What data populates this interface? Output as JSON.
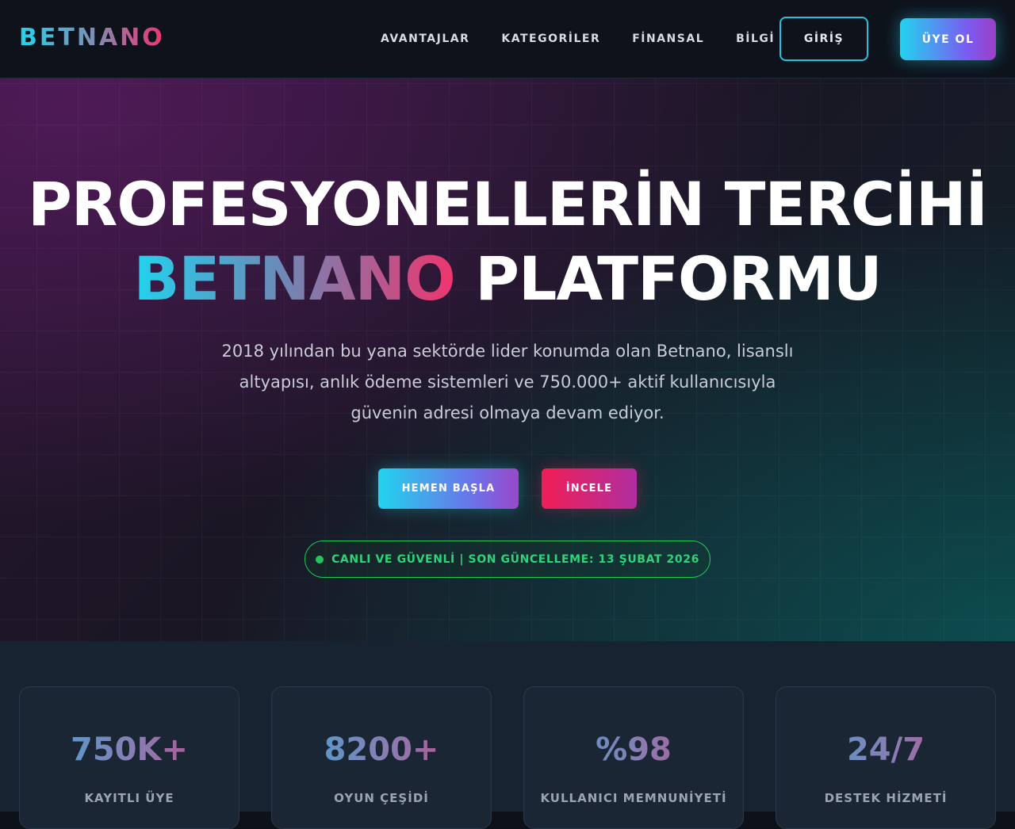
{
  "brand": {
    "logo_text": "BETNANO"
  },
  "nav": {
    "items": [
      {
        "label": "AVANTAJLAR"
      },
      {
        "label": "KATEGORİLER"
      },
      {
        "label": "FİNANSAL"
      },
      {
        "label": "BİLGİ"
      }
    ],
    "login_label": "GİRİŞ",
    "register_label": "ÜYE OL"
  },
  "hero": {
    "title_line1": "PROFESYONELLERİN TERCİHİ",
    "title_accent": "BETNANO",
    "title_line2_rest": " PLATFORMU",
    "description": "2018 yılından bu yana sektörde lider konumda olan Betnano, lisanslı altyapısı, anlık ödeme sistemleri ve 750.000+ aktif kullanıcısıyla güvenin adresi olmaya devam ediyor.",
    "primary_cta": "HEMEN BAŞLA",
    "secondary_cta": "İNCELE",
    "status_text": "CANLI VE GÜVENLİ | SON GÜNCELLEME: 13 ŞUBAT 2026"
  },
  "stats": [
    {
      "value": "750K+",
      "label": "KAYITLI ÜYE"
    },
    {
      "value": "8200+",
      "label": "OYUN ÇEŞİDİ"
    },
    {
      "value": "%98",
      "label": "KULLANICI MEMNUNİYETİ"
    },
    {
      "value": "24/7",
      "label": "DESTEK HİZMETİ"
    }
  ],
  "colors": {
    "accent_cyan": "#22d3ee",
    "accent_pink": "#f0346e",
    "status_green": "#22c55e",
    "background": "#0d111a"
  }
}
